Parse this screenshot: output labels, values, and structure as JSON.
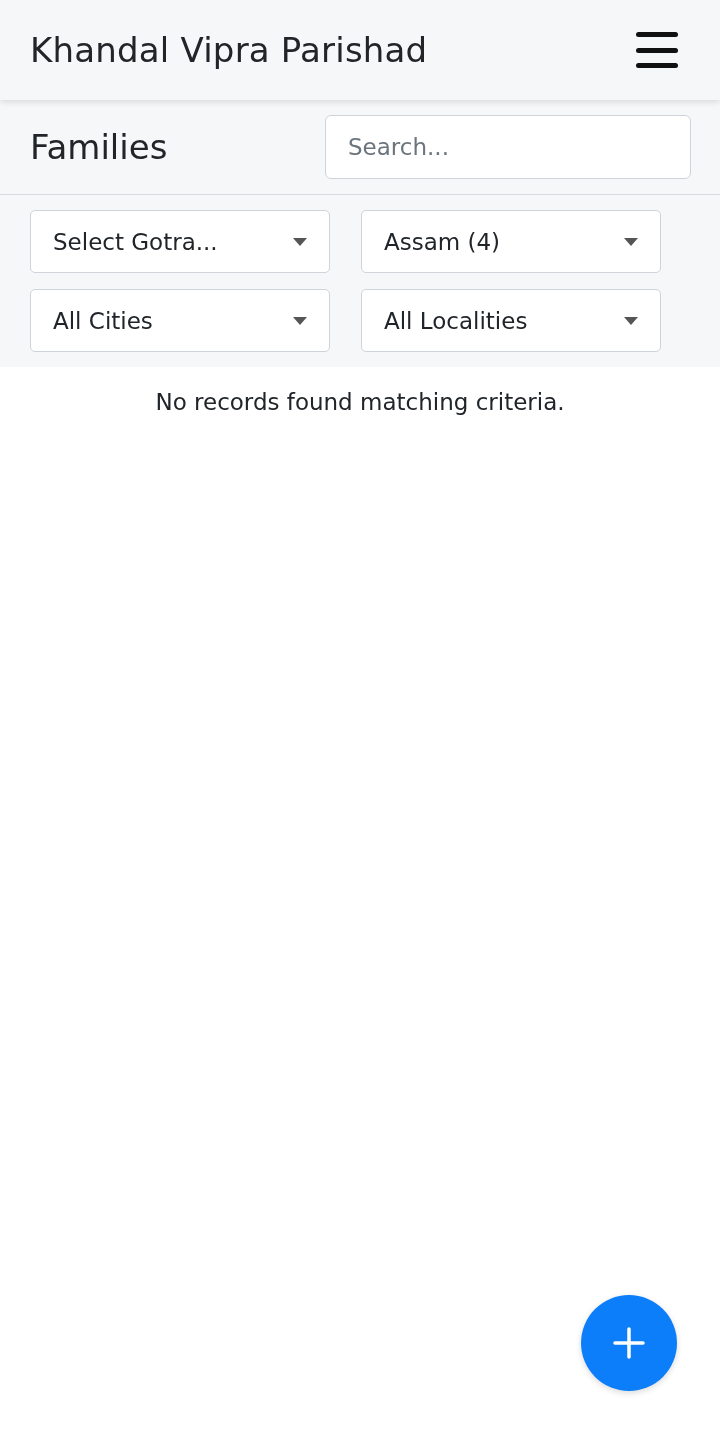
{
  "header": {
    "title": "Khandal Vipra Parishad"
  },
  "page": {
    "title": "Families",
    "search": {
      "placeholder": "Search..."
    }
  },
  "filters": [
    {
      "value": "Select Gotra..."
    },
    {
      "value": "Assam (4)"
    },
    {
      "value": "All Cities"
    },
    {
      "value": "All Localities"
    }
  ],
  "empty_message": "No records found matching criteria."
}
